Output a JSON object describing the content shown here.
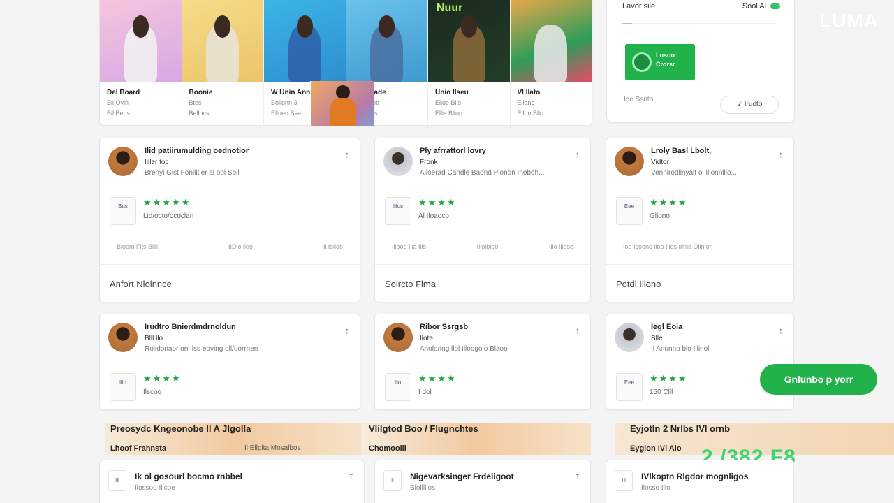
{
  "brand": "LUMA",
  "gallery": [
    {
      "title": "Del Board",
      "lines": [
        "Bil Ovin",
        "Bil Bens"
      ],
      "color_a": "#f4b7d2",
      "color_b": "#d49bde"
    },
    {
      "title": "Boonie",
      "lines": [
        "Btos",
        "Bellocs"
      ],
      "color_a": "#f4d37a",
      "color_b": "#e8c26d"
    },
    {
      "title": "W Unin Anne",
      "lines": [
        "Bollonn 3",
        "Ellnen Bsa"
      ],
      "color_a": "#3bb6e6",
      "color_b": "#3f9cdc"
    },
    {
      "title": "Blio Illade",
      "lines": [
        "Bllo Bilob",
        "Elllon Bs"
      ],
      "color_a": "#62bde8",
      "color_b": "#4aa0d4"
    },
    {
      "title": "Unio Ilseu",
      "lines": [
        "Elloe Blis",
        "Ellis Bllon"
      ],
      "color_a": "#1a2a1e",
      "color_b": "#203b28"
    },
    {
      "title": "Vl Ilato",
      "lines": [
        "Ellanc",
        "Ellon Bllo"
      ],
      "color_a": "#f3a84b",
      "color_b": "#e59a3c"
    }
  ],
  "gallery_overlay_label": "Nuur",
  "side_panel": {
    "label": "Lavor sile",
    "value": "Sool Al",
    "promo_line1": "Losoo",
    "promo_line2": "Crorsr",
    "footer": "Ioe Ssnto",
    "button": "↙ Irudto"
  },
  "reviewers": [
    {
      "name": "Ilid patiirumulding oednotior",
      "role": "Iiller toc",
      "sub": "Brenyi Gist Fonilitler al ool Soil",
      "logo": "Bus",
      "stars": "★★★★★",
      "count": "Lid/octo/ococlan",
      "stats": [
        "Bloom Fits Blill",
        "IIDlo lloo",
        "Il lolloo"
      ],
      "footer": "Anfort Nlolnnce",
      "light": false
    },
    {
      "name": "Ply afrrattorl lovry",
      "role": "Fronk",
      "sub": "Alloerad Candle Baond Plonon Inoboh...",
      "logo": "Illus",
      "stars": "★★★★",
      "count": "Al Iloaoco",
      "stats": [
        "Illooo Illa Ills",
        "Illolbloo",
        "Illo Illose"
      ],
      "footer": "Solrcto Flma",
      "light": true
    },
    {
      "name": "Lroly Basl Lbolt,",
      "role": "Vidtor",
      "sub": "Vennlrodlinyalt ol Illonnlllo...",
      "logo": "Eee",
      "stars": "★★★★",
      "count": "Gllono",
      "stats": [
        "Ioo Icoono lloo Illes Illnlo Ollnlon"
      ],
      "footer": "Potdl Illono",
      "light": false
    },
    {
      "name": "Irudtro Bnierdmdrnoldun",
      "role": "Blll llo",
      "sub": "Rolidonaor on Ilss eoving oll/uorrnen",
      "logo": "lllo",
      "stars": "★★★★",
      "count": "Ilscoo",
      "stats": [],
      "footer": "",
      "light": false
    },
    {
      "name": "Ribor Ssrgsb",
      "role": "Ilote",
      "sub": "Anoloring llol Illoogolo Blaoo",
      "logo": "Ilo",
      "stars": "★★★★",
      "count": "I dol",
      "stats": [],
      "footer": "",
      "light": false
    },
    {
      "name": "Iegl Eoia",
      "role": "Blle",
      "sub": "Il Anunno blo Illinol",
      "logo": "Eee",
      "stars": "★★★★",
      "count": "150 Clll",
      "stats": [],
      "footer": "",
      "light": true
    }
  ],
  "signup_button": "Gnlunbo p yorr",
  "banners": [
    {
      "heading": "Preosydc Kngeonobe  Il   A Jlgolla",
      "sub": "Lhoof Frahnsta",
      "meta": "Il  Ellplta Mosalbos"
    },
    {
      "heading": "Vlilgtod Boo / Flugnchtes",
      "sub": "Chomoolll",
      "meta": ""
    },
    {
      "heading": "Eyjotln 2 Nrlbs    IVl ornb",
      "sub": "Eyglon IVl   Alo",
      "meta": ""
    }
  ],
  "big_number": "2 /382 F8",
  "listings": [
    {
      "title": "Ik ol gosourl bocmo rnbbel",
      "sub": "Ilossoo Illcoe",
      "icon": "Ill"
    },
    {
      "title": "Nigevarksinger Frdeligoot",
      "sub": "Blolllllos",
      "icon": "ll"
    },
    {
      "title": "IVlkoptn Rlgdor mognligos",
      "sub": "Ilosso Illo",
      "icon": "Ill"
    }
  ]
}
